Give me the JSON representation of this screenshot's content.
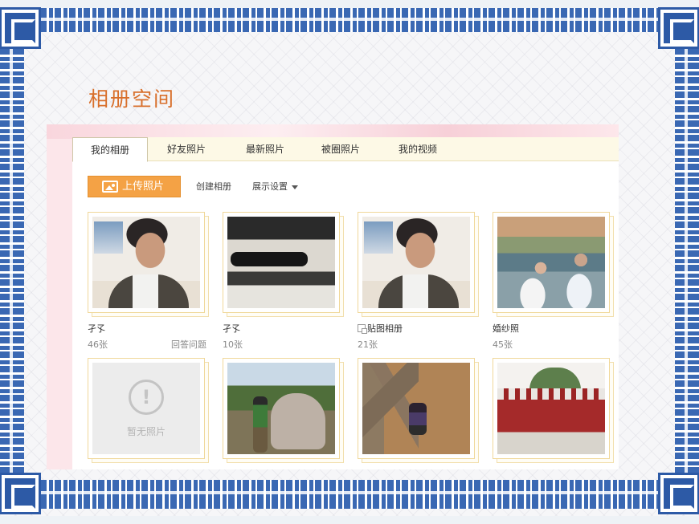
{
  "page": {
    "title": "相册空间"
  },
  "tabs": [
    {
      "label": "我的相册",
      "active": true
    },
    {
      "label": "好友照片",
      "active": false
    },
    {
      "label": "最新照片",
      "active": false
    },
    {
      "label": "被圈照片",
      "active": false
    },
    {
      "label": "我的视频",
      "active": false
    }
  ],
  "toolbar": {
    "upload_label": "上传照片",
    "create_album_label": "创建相册",
    "display_settings_label": "展示设置"
  },
  "albums_row1": [
    {
      "name": "孑孓",
      "count": "46张",
      "extra": "回答问题",
      "photo": "portrait",
      "icon": "none"
    },
    {
      "name": "孑孓",
      "count": "10张",
      "extra": "",
      "photo": "upside-down-scene",
      "icon": "none"
    },
    {
      "name": "贴图相册",
      "count": "21张",
      "extra": "",
      "photo": "portrait",
      "icon": "sticker-icon"
    },
    {
      "name": "婚纱照",
      "count": "45张",
      "extra": "",
      "photo": "wedding-couple",
      "icon": "none"
    }
  ],
  "albums_row2": [
    {
      "photo": "empty",
      "empty_text": "暂无照片",
      "icon": "exclamation-icon"
    },
    {
      "photo": "elephant-statue"
    },
    {
      "photo": "tree-and-house"
    },
    {
      "photo": "red-building"
    }
  ],
  "colors": {
    "title": "#d86f2b",
    "border_blue": "#3a68b3",
    "upload_button": "#f4a245",
    "tab_bar": "#fdf9e6",
    "panel_pink": "#fce6ea"
  }
}
